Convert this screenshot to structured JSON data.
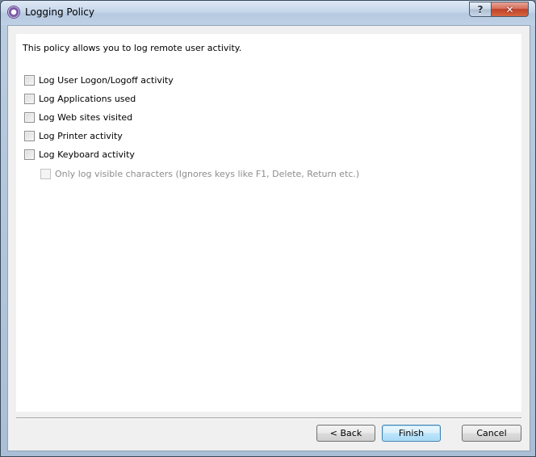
{
  "window": {
    "title": "Logging Policy",
    "help_label": "?",
    "close_label": "✕"
  },
  "intro_text": "This policy allows you to log remote user activity.",
  "options": [
    {
      "label": "Log User Logon/Logoff activity",
      "checked": false,
      "enabled": true
    },
    {
      "label": "Log Applications used",
      "checked": false,
      "enabled": true
    },
    {
      "label": "Log Web sites visited",
      "checked": false,
      "enabled": true
    },
    {
      "label": "Log Printer activity",
      "checked": false,
      "enabled": true
    },
    {
      "label": "Log Keyboard activity",
      "checked": false,
      "enabled": true
    },
    {
      "label": "Only log visible characters (Ignores keys like F1, Delete, Return etc.)",
      "checked": false,
      "enabled": false
    }
  ],
  "buttons": {
    "back": "< Back",
    "finish": "Finish",
    "cancel": "Cancel"
  },
  "icons": {
    "app": "app-logo-icon",
    "help": "help-icon",
    "close": "close-icon"
  }
}
